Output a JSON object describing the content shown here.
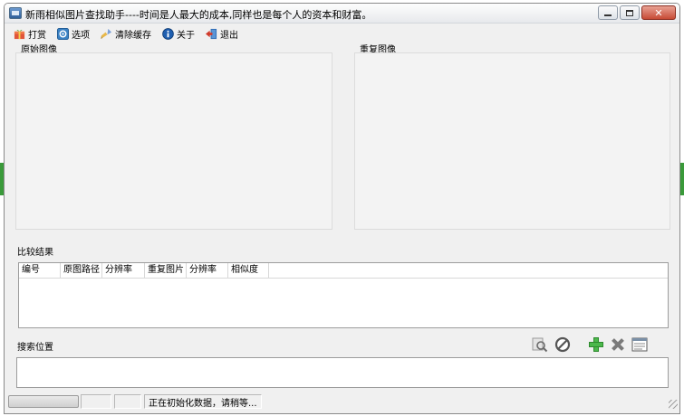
{
  "window": {
    "title": "新雨相似图片查找助手----时间是人最大的成本,同样也是每个人的资本和财富。",
    "icon": "app-window-icon"
  },
  "toolbar": {
    "items": [
      {
        "label": "打赏",
        "icon": "gift-icon"
      },
      {
        "label": "选项",
        "icon": "options-icon"
      },
      {
        "label": "清除缓存",
        "icon": "broom-icon"
      },
      {
        "label": "关于",
        "icon": "info-icon"
      },
      {
        "label": "退出",
        "icon": "exit-door-icon"
      }
    ]
  },
  "panels": {
    "original_label": "原始图像",
    "duplicate_label": "重复图像"
  },
  "results": {
    "label": "比较结果",
    "columns": [
      "编号",
      "原图路径",
      "分辨率",
      "重复图片",
      "分辨率",
      "相似度"
    ]
  },
  "search": {
    "label": "搜索位置",
    "tools": [
      "search-image-icon",
      "stop-icon",
      "add-icon",
      "delete-icon",
      "folder-list-icon"
    ]
  },
  "status": {
    "message": "正在初始化数据，请稍等..."
  },
  "colors": {
    "accent_green": "#3aa33a",
    "close_red": "#c74a35",
    "panel_bg": "#f3f3f3"
  }
}
